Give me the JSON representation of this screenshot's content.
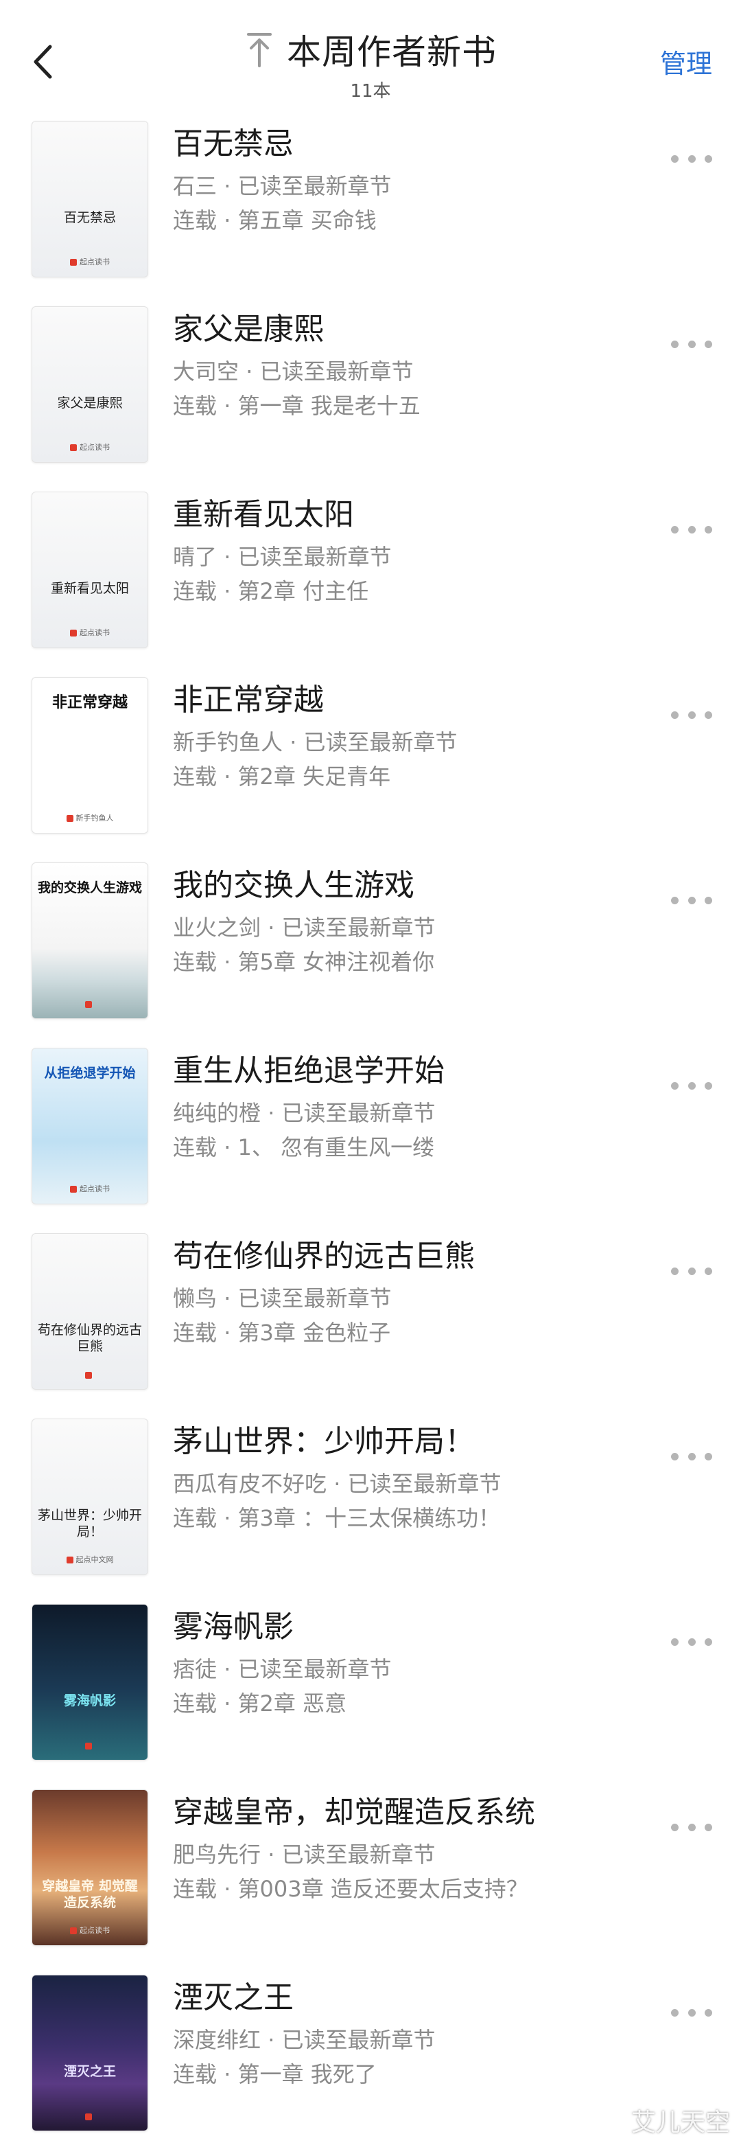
{
  "header": {
    "back_icon": "chevron-left-icon",
    "pin_icon": "pin-to-top-icon",
    "title": "本周作者新书",
    "count": "11本",
    "manage": "管理",
    "accent_color": "#2d73d6"
  },
  "books": [
    {
      "title": "百无禁忌",
      "author": "石三",
      "read_status": "已读至最新章节",
      "state": "连载",
      "chapter": "第五章 买命钱",
      "cover_title": "百无禁忌",
      "cover_pub": "起点读书",
      "cover_style": "light"
    },
    {
      "title": "家父是康熙",
      "author": "大司空",
      "read_status": "已读至最新章节",
      "state": "连载",
      "chapter": "第一章 我是老十五",
      "cover_title": "家父是康熙",
      "cover_pub": "起点读书",
      "cover_style": "light"
    },
    {
      "title": "重新看见太阳",
      "author": "晴了",
      "read_status": "已读至最新章节",
      "state": "连载",
      "chapter": "第2章 付主任",
      "cover_title": "重新看见太阳",
      "cover_pub": "起点读书",
      "cover_style": "light"
    },
    {
      "title": "非正常穿越",
      "author": "新手钓鱼人",
      "read_status": "已读至最新章节",
      "state": "连载",
      "chapter": "第2章 失足青年",
      "cover_title": "非正常穿越",
      "cover_pub": "新手钓鱼人",
      "cover_style": "comic"
    },
    {
      "title": "我的交换人生游戏",
      "author": "业火之剑",
      "read_status": "已读至最新章节",
      "state": "连载",
      "chapter": "第5章 女神注视着你",
      "cover_title": "我的交换人生游戏",
      "cover_pub": "",
      "cover_style": "mountain"
    },
    {
      "title": "重生从拒绝退学开始",
      "author": "纯纯的橙",
      "read_status": "已读至最新章节",
      "state": "连载",
      "chapter": "1、 忽有重生风一缕",
      "cover_title": "从拒绝退学开始",
      "cover_pub": "起点读书",
      "cover_style": "blue"
    },
    {
      "title": "苟在修仙界的远古巨熊",
      "author": "懒鸟",
      "read_status": "已读至最新章节",
      "state": "连载",
      "chapter": "第3章 金色粒子",
      "cover_title": "苟在修仙界的远古巨熊",
      "cover_pub": "",
      "cover_style": "light"
    },
    {
      "title": "茅山世界：少帅开局！",
      "author": "西瓜有皮不好吃",
      "read_status": "已读至最新章节",
      "state": "连载",
      "chapter": "第3章 ：十三太保横练功！",
      "cover_title": "茅山世界：少帅开局！",
      "cover_pub": "起点中文网",
      "cover_style": "light"
    },
    {
      "title": "雾海帆影",
      "author": "痞徒",
      "read_status": "已读至最新章节",
      "state": "连载",
      "chapter": "第2章 恶意",
      "cover_title": "雾海帆影",
      "cover_pub": "",
      "cover_style": "dark"
    },
    {
      "title": "穿越皇帝，却觉醒造反系统",
      "author": "肥鸟先行",
      "read_status": "已读至最新章节",
      "state": "连载",
      "chapter": "第003章 造反还要太后支持？",
      "cover_title": "穿越皇帝 却觉醒造反系统",
      "cover_pub": "起点读书",
      "cover_style": "sunset"
    },
    {
      "title": "湮灭之王",
      "author": "深度绯红",
      "read_status": "已读至最新章节",
      "state": "连载",
      "chapter": "第一章 我死了",
      "cover_title": "湮灭之王",
      "cover_pub": "",
      "cover_style": "purple"
    }
  ],
  "watermark": "艾儿天空"
}
